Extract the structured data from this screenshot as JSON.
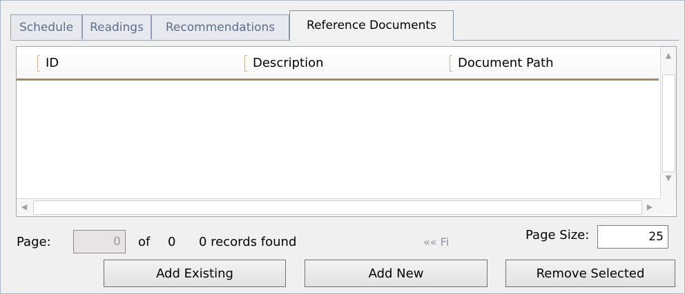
{
  "tabs": [
    {
      "label": "Schedule",
      "active": false
    },
    {
      "label": "Readings",
      "active": false
    },
    {
      "label": "Recommendations",
      "active": false
    },
    {
      "label": "Reference Documents",
      "active": true
    }
  ],
  "grid": {
    "columns": [
      "ID",
      "Description",
      "Document Path"
    ],
    "rows": []
  },
  "pager": {
    "page_label": "Page:",
    "page_value": "0",
    "of_label": "of",
    "total_pages": "0",
    "records_text": "0 records found",
    "nav_text": "«« Fi",
    "page_size_label": "Page Size:",
    "page_size_value": "25"
  },
  "buttons": {
    "add_existing": "Add Existing",
    "add_new": "Add New",
    "remove_selected": "Remove Selected"
  }
}
